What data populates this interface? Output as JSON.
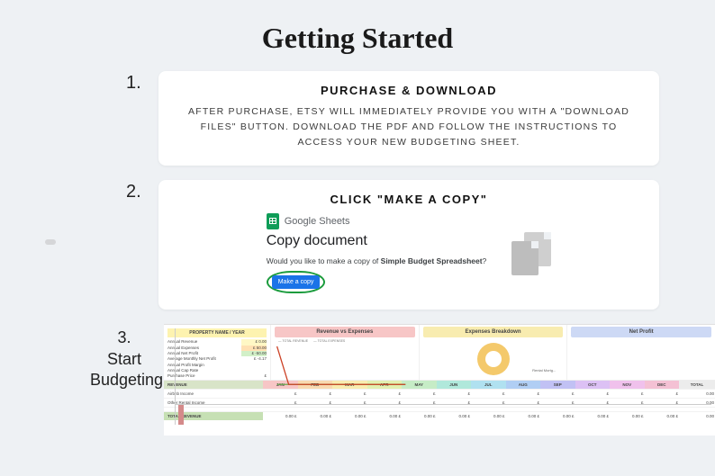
{
  "title": "Getting Started",
  "step1": {
    "num": "1.",
    "heading": "PURCHASE & DOWNLOAD",
    "body": "AFTER PURCHASE, ETSY WILL IMMEDIATELY PROVIDE YOU WITH A \"DOWNLOAD FILES\" BUTTON. DOWNLOAD THE PDF AND FOLLOW THE INSTRUCTIONS TO ACCESS YOUR NEW BUDGETING SHEET."
  },
  "step2": {
    "num": "2.",
    "heading": "CLICK \"MAKE A COPY\"",
    "gs_label": "Google Sheets",
    "dialog_title": "Copy document",
    "question_prefix": "Would you like to make a copy of ",
    "question_bold": "Simple Budget Spreadsheet",
    "question_suffix": "?",
    "button": "Make a copy"
  },
  "step3": {
    "num": "3.",
    "label_line1": "Start",
    "label_line2": "Budgeting"
  },
  "sheet": {
    "prop_header": "PROPERTY NAME / YEAR",
    "rows": [
      {
        "label": "Annual Revenue",
        "val": "£    0.00"
      },
      {
        "label": "Annual Expenses",
        "val": "£   50.00"
      },
      {
        "label": "Annual Net Profit",
        "val": "£  -50.00"
      },
      {
        "label": "Average Monthly Net Profit",
        "val": "£   -4.17"
      },
      {
        "label": "Annual Profit Margin",
        "val": ""
      },
      {
        "label": "Annual Cap Rate",
        "val": ""
      },
      {
        "label": "Purchase Price",
        "val": "£"
      }
    ],
    "chart1_title": "Revenue vs Expenses",
    "chart1_legend_a": "TOTAL REVENUE",
    "chart1_legend_b": "TOTAL EXPENSES",
    "chart2_title": "Expenses Breakdown",
    "chart2_label": "Rental Mortg...",
    "chart3_title": "Net Profit",
    "months": [
      "JAN",
      "FEB",
      "MAR",
      "APR",
      "MAY",
      "JUN",
      "JUL",
      "AUG",
      "SEP",
      "OCT",
      "NOV",
      "DEC",
      "TOTAL"
    ],
    "month_classes": [
      "m-jan",
      "m-feb",
      "m-mar",
      "m-apr",
      "m-may",
      "m-jun",
      "m-jul",
      "m-aug",
      "m-sep",
      "m-oct",
      "m-nov",
      "m-dec",
      "m-total"
    ],
    "section_revenue": "REVENUE",
    "row_airbnb": "Airbnb Income",
    "row_other": "Other Rental Income",
    "row_total": "TOTAL REVENUE",
    "cell_blank": "£",
    "cell_zero": "£    0.00",
    "cell_zero_tight": "0.00"
  },
  "chart_data": [
    {
      "type": "line",
      "title": "Revenue vs Expenses",
      "x": [
        "JAN",
        "FEB",
        "MAR",
        "APR",
        "MAY",
        "JUN",
        "JUL",
        "AUG",
        "SEP",
        "OCT",
        "NOV",
        "DEC"
      ],
      "series": [
        {
          "name": "TOTAL REVENUE",
          "values": [
            0,
            0,
            0,
            0,
            0,
            0,
            0,
            0,
            0,
            0,
            0,
            0
          ]
        },
        {
          "name": "TOTAL EXPENSES",
          "values": [
            50,
            0,
            0,
            0,
            0,
            0,
            0,
            0,
            0,
            0,
            0,
            0
          ]
        }
      ],
      "ylim": [
        0,
        60
      ]
    },
    {
      "type": "pie",
      "title": "Expenses Breakdown",
      "categories": [
        "Rental Mortg..."
      ],
      "values": [
        100
      ]
    },
    {
      "type": "bar",
      "title": "Net Profit",
      "categories": [
        "JAN",
        "FEB",
        "MAR",
        "APR",
        "MAY",
        "JUN",
        "JUL",
        "AUG",
        "SEP",
        "OCT",
        "NOV",
        "DEC"
      ],
      "values": [
        -50,
        0,
        0,
        0,
        0,
        0,
        0,
        0,
        0,
        0,
        0,
        0
      ],
      "ylim": [
        -60,
        10
      ]
    }
  ]
}
